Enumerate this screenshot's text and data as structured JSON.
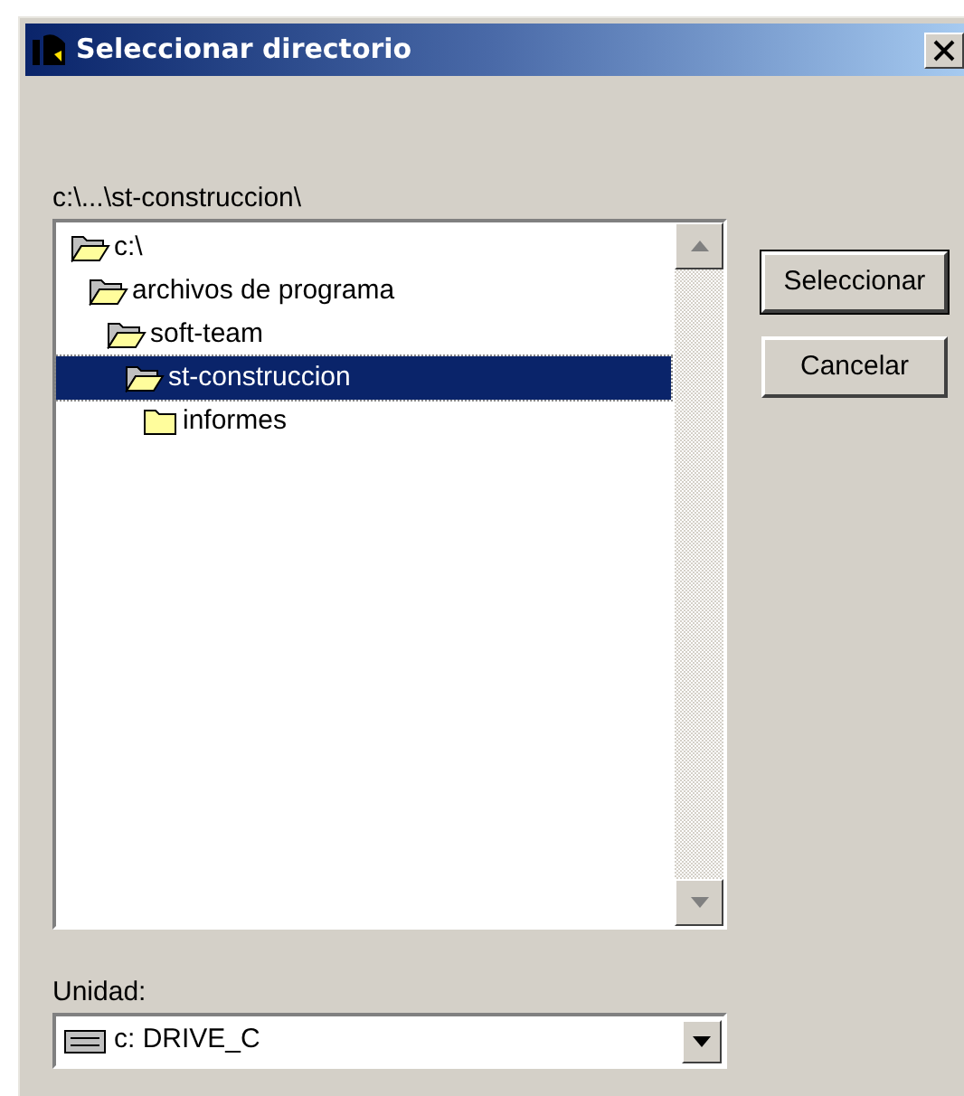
{
  "window": {
    "title": "Seleccionar directorio"
  },
  "path": "c:\\...\\st-construccion\\",
  "tree": [
    {
      "label": "c:\\",
      "expanded": true,
      "selected": false,
      "children": [
        {
          "label": "archivos de programa",
          "expanded": true,
          "selected": false,
          "children": [
            {
              "label": "soft-team",
              "expanded": true,
              "selected": false,
              "children": [
                {
                  "label": "st-construccion",
                  "expanded": true,
                  "selected": true,
                  "children": [
                    {
                      "label": "informes",
                      "expanded": false,
                      "selected": false
                    }
                  ]
                }
              ]
            }
          ]
        }
      ]
    }
  ],
  "buttons": [
    {
      "label": "Seleccionar",
      "default": true
    },
    {
      "label": "Cancelar",
      "default": false
    }
  ],
  "drive": {
    "label": "Unidad:",
    "value": "c: DRIVE_C"
  }
}
